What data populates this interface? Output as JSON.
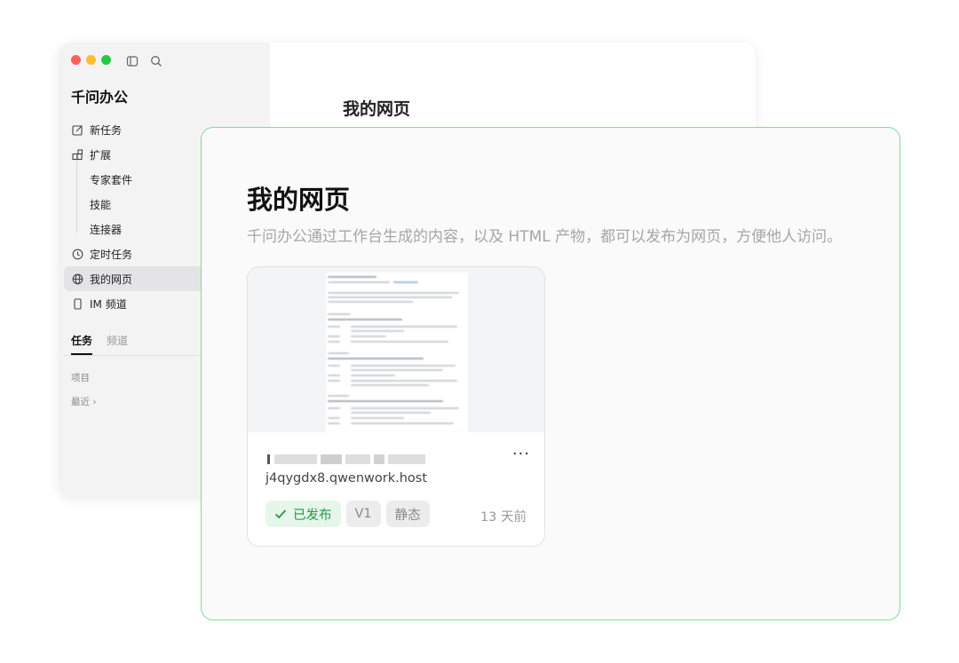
{
  "app": {
    "brand": "千问办公",
    "nav": [
      {
        "label": "新任务",
        "icon": "edit-icon"
      },
      {
        "label": "扩展",
        "icon": "extension-icon"
      },
      {
        "label": "专家套件"
      },
      {
        "label": "技能"
      },
      {
        "label": "连接器"
      },
      {
        "label": "定时任务",
        "icon": "clock-icon"
      },
      {
        "label": "我的网页",
        "icon": "globe-icon",
        "active": true
      },
      {
        "label": "IM 频道",
        "icon": "phone-icon"
      }
    ],
    "tabs": [
      "任务",
      "频道"
    ],
    "sections": {
      "projects": "项目",
      "recent": "最近 ›"
    },
    "main_title": "我的网页"
  },
  "panel": {
    "title": "我的网页",
    "description": "千问办公通过工作台生成的内容，以及 HTML 产物，都可以发布为网页，方便他人访问。",
    "card": {
      "more": "···",
      "host": "j4qygdx8.qwenwork.host",
      "status": "已发布",
      "version": "V1",
      "type": "静态",
      "time": "13 天前"
    }
  },
  "colors": {
    "accent_border": "#7fdc9c",
    "published_bg": "#e6f6ea",
    "published_text": "#1f9a45"
  }
}
